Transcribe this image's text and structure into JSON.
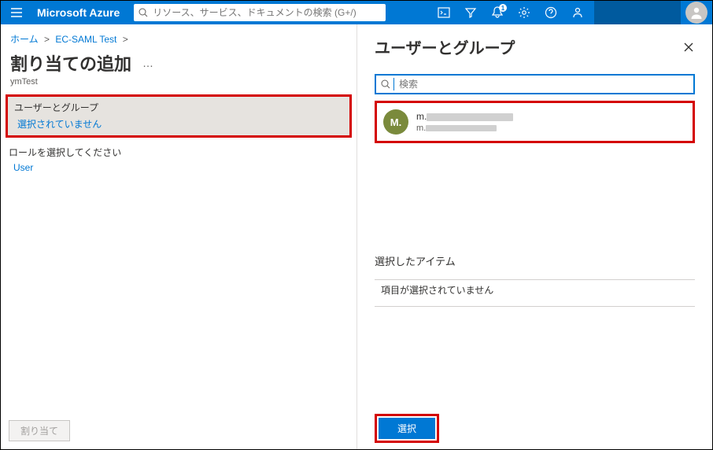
{
  "topbar": {
    "brand": "Microsoft Azure",
    "search_placeholder": "リソース、サービス、ドキュメントの検索 (G+/)",
    "notification_badge": "1"
  },
  "breadcrumb": {
    "home": "ホーム",
    "app": "EC-SAML Test"
  },
  "page": {
    "title": "割り当ての追加",
    "more": "…",
    "subtitle": "ymTest"
  },
  "users_groups_box": {
    "header": "ユーザーとグループ",
    "value": "選択されていません"
  },
  "role_box": {
    "header": "ロールを選択してください",
    "value": "User"
  },
  "left_footer": {
    "assign": "割り当て"
  },
  "panel": {
    "title": "ユーザーとグループ",
    "search_placeholder": "検索",
    "result": {
      "initial": "M.",
      "line1_prefix": "m.",
      "line2_prefix": "m."
    },
    "selected_header": "選択したアイテム",
    "selected_none": "項目が選択されていません",
    "select_button": "選択"
  }
}
